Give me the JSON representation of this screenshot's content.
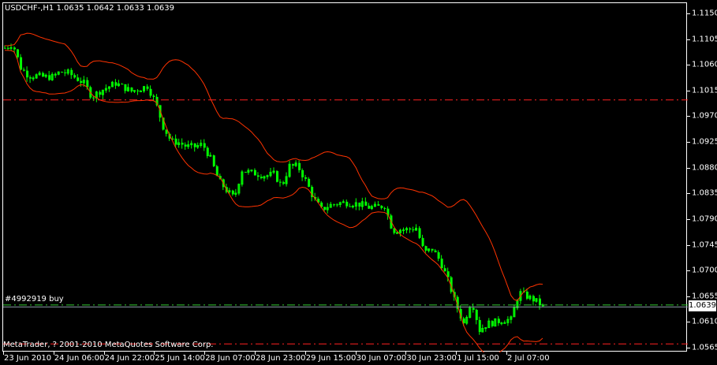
{
  "header": {
    "title": "USDCHF-,H1  1.0635 1.0642 1.0633 1.0639"
  },
  "order": {
    "label": "#4992919 buy",
    "price": 1.0641,
    "color": "#33cc33"
  },
  "levels": {
    "stop_loss": 1.0573,
    "take_profit": 1.1,
    "color": "#ff2020"
  },
  "bid": {
    "price": "1.0639",
    "value": 1.0639,
    "color": "#8a9aa8"
  },
  "copyright": "MetaTrader, ? 2001-2010 MetaQuotes Software Corp.",
  "colors": {
    "candle": "#00ff00",
    "bands": "#ff3300",
    "background": "#000000"
  },
  "price_axis": {
    "min": 1.0565,
    "max": 1.115,
    "labels": [
      "1.1150",
      "1.1105",
      "1.1060",
      "1.1015",
      "1.0970",
      "1.0925",
      "1.0880",
      "1.0835",
      "1.0790",
      "1.0745",
      "1.0700",
      "1.0655",
      "1.0610",
      "1.0565"
    ]
  },
  "time_axis": {
    "labels": [
      "23 Jun 2010",
      "24 Jun 06:00",
      "24 Jun 22:00",
      "25 Jun 14:00",
      "28 Jun 07:00",
      "28 Jun 23:00",
      "29 Jun 15:00",
      "30 Jun 07:00",
      "30 Jun 23:00",
      "1 Jul 15:00",
      "2 Jul 07:00"
    ]
  },
  "chart_data": {
    "type": "candlestick",
    "symbol": "USDCHF-",
    "timeframe": "H1",
    "indicator": "Bollinger Bands",
    "close_path": [
      1.1091,
      1.1098,
      1.1056,
      1.1042,
      1.1042,
      1.104,
      1.104,
      1.1049,
      1.1047,
      1.1038,
      1.1029,
      1.1005,
      1.1015,
      1.1022,
      1.1029,
      1.1022,
      1.1015,
      1.1019,
      1.1024,
      1.0997,
      1.0953,
      1.0928,
      1.0925,
      1.0918,
      1.0918,
      1.0922,
      1.0897,
      1.0859,
      1.0842,
      1.0828,
      1.0877,
      1.0873,
      1.087,
      1.0867,
      1.087,
      1.0849,
      1.0884,
      1.0884,
      1.0859,
      1.0828,
      1.0808,
      1.0815,
      1.0819,
      1.082,
      1.0819,
      1.0817,
      1.0812,
      1.0812,
      1.0815,
      1.0771,
      1.0773,
      1.0773,
      1.0776,
      1.0732,
      1.0739,
      1.0718,
      1.0684,
      1.0642,
      1.0608,
      1.0649,
      1.0597,
      1.0608,
      1.0611,
      1.0615,
      1.0615,
      1.0663,
      1.0656,
      1.0649,
      1.0639
    ]
  }
}
